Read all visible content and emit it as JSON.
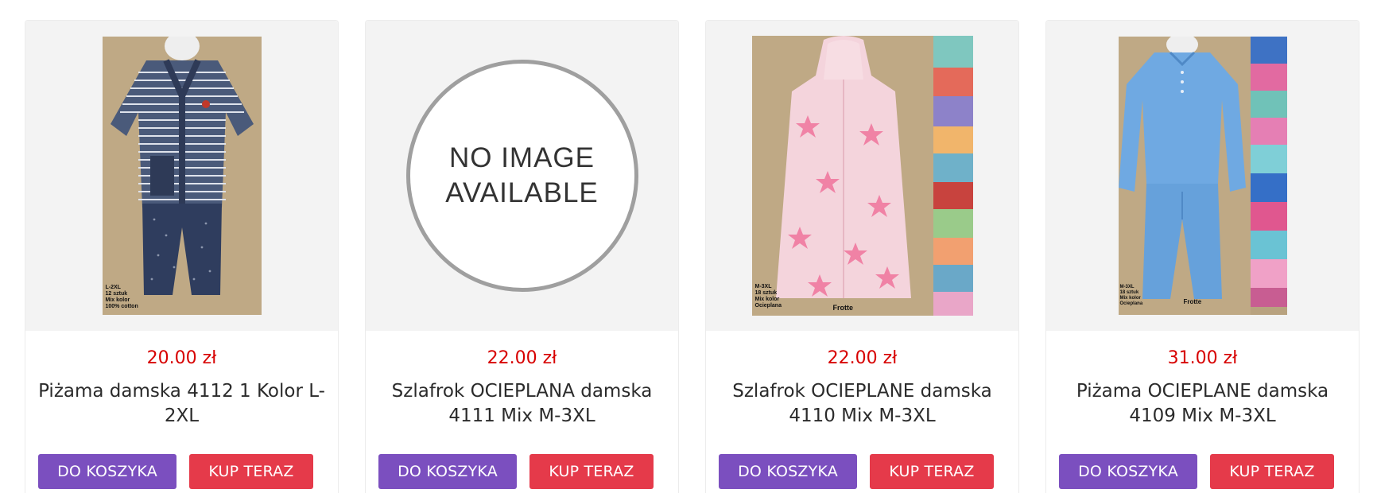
{
  "products": [
    {
      "price": "20.00 zł",
      "title": "Piżama damska 4112 1 Kolor L-2XL",
      "image_labels": [
        "L-2XL",
        "12 sztuk",
        "Mix kolor",
        "100% cotton"
      ],
      "image_caption": ""
    },
    {
      "price": "22.00 zł",
      "title": "Szlafrok OCIEPLANA damska 4111 Mix M-3XL",
      "placeholder_line1": "NO IMAGE",
      "placeholder_line2": "AVAILABLE"
    },
    {
      "price": "22.00 zł",
      "title": "Szlafrok OCIEPLANE damska 4110 Mix M-3XL",
      "image_labels": [
        "M-3XL",
        "18 sztuk",
        "Mix kolor",
        "Ocieplana"
      ],
      "image_caption": "Frotte"
    },
    {
      "price": "31.00 zł",
      "title": "Piżama OCIEPLANE damska 4109 Mix M-3XL",
      "image_labels": [
        "M-3XL",
        "18 sztuk",
        "Mix kolor",
        "Ocieplana"
      ],
      "image_caption": "Frotte"
    }
  ],
  "buttons": {
    "add_to_cart": "DO KOSZYKA",
    "buy_now": "KUP TERAZ"
  },
  "colors": {
    "price": "#d70000",
    "cart_button": "#7b4fbf",
    "buy_button": "#e53a4a",
    "image_background": "#f3f3f3"
  }
}
